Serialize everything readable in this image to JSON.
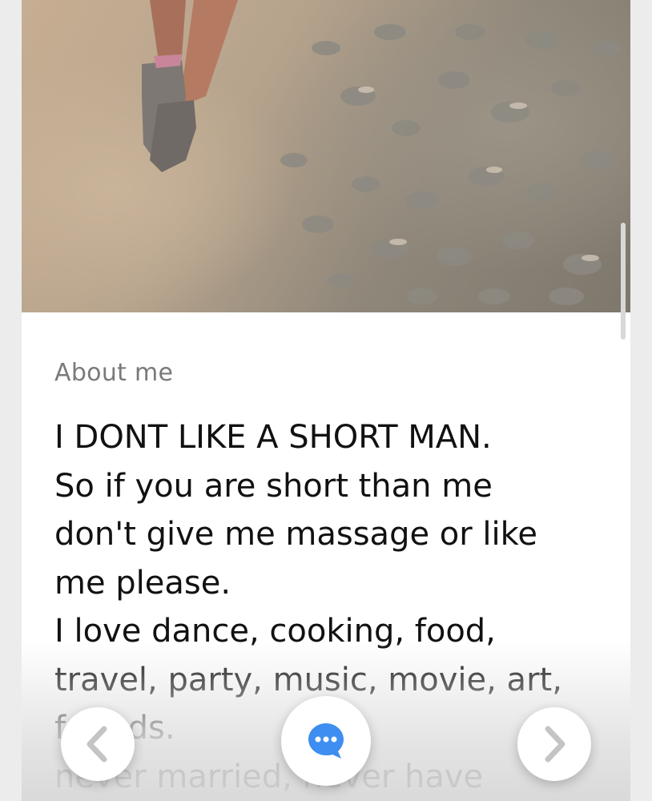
{
  "profile": {
    "about_label": "About me",
    "bio_lines": [
      "I DONT LIKE A SHORT MAN.",
      "So if you are short than me",
      "don't give me massage or like",
      "me please.",
      "I love dance, cooking, food,",
      "travel, party, music, movie, art,",
      "friends.",
      "never married, never have"
    ]
  },
  "photo": {
    "description_icon": "profile-photo"
  },
  "controls": {
    "prev_icon": "chevron-left-icon",
    "next_icon": "chevron-right-icon",
    "message_icon": "chat-bubble-icon"
  },
  "colors": {
    "message_accent": "#3d8ef0",
    "chevron": "#c4c4c4"
  }
}
